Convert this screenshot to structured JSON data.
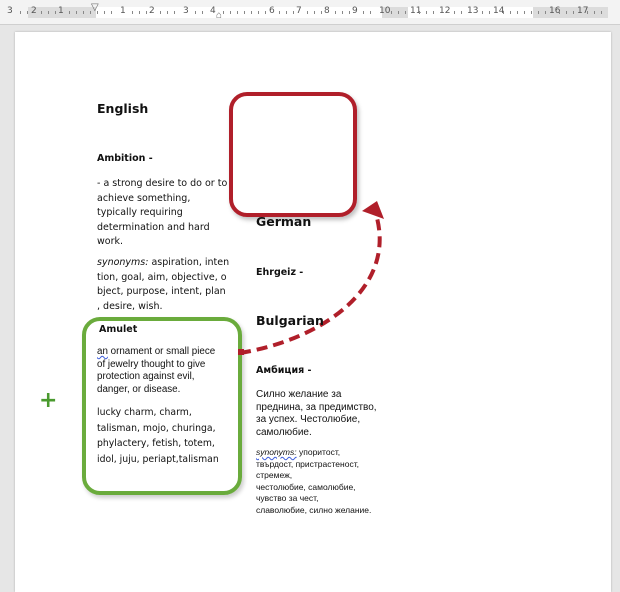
{
  "ruler": {
    "numbers": [
      "3",
      "2",
      "1",
      "1",
      "2",
      "3",
      "4",
      "6",
      "7",
      "8",
      "9",
      "10",
      "11",
      "12",
      "13",
      "14",
      "16",
      "17"
    ]
  },
  "document": {
    "english": {
      "heading": "English",
      "term": "Ambition -",
      "definition_lines": [
        "- a strong desire to do or to",
        "achieve something,",
        "typically requiring",
        "determination and hard",
        "work."
      ],
      "synonyms_label": "synonyms:",
      "synonyms_lines": [
        " aspiration, inten",
        "tion, goal, aim, objective, o",
        "bject, purpose, intent, plan",
        ", desire, wish."
      ]
    },
    "amulet": {
      "term": "Amulet",
      "definition_first_word": "an",
      "definition_lines": [
        " ornament or small piece",
        "of jewelry thought to give",
        "protection against evil,",
        "danger, or disease."
      ],
      "synonyms_lines": [
        "lucky charm, charm,",
        "talisman, mojo, churinga,",
        "phylactery, fetish, totem,",
        "idol, juju, periapt,talisman"
      ]
    },
    "german": {
      "heading": "German",
      "term": "Ehrgeiz -"
    },
    "bulgarian": {
      "heading": "Bulgarian",
      "term": "Амбиция -",
      "definition_lines": [
        "Силно желание за",
        "преднина, за предимство,",
        "за успех. Честолюбие,",
        "самолюбие."
      ],
      "synonyms_label": "synonyms:",
      "synonyms_lines": [
        " упоритост,",
        "твърдост, пристрастеност,",
        "стремеж,",
        "честолюбие, самолюбие,",
        "чувство за чест,",
        "славолюбие, силно желание."
      ]
    }
  },
  "colors": {
    "red_box": "#b01f2a",
    "green_box": "#6aab3c",
    "arrow": "#b01f2a",
    "plus": "#4a9a2e"
  },
  "icons": {
    "plus": "+"
  }
}
